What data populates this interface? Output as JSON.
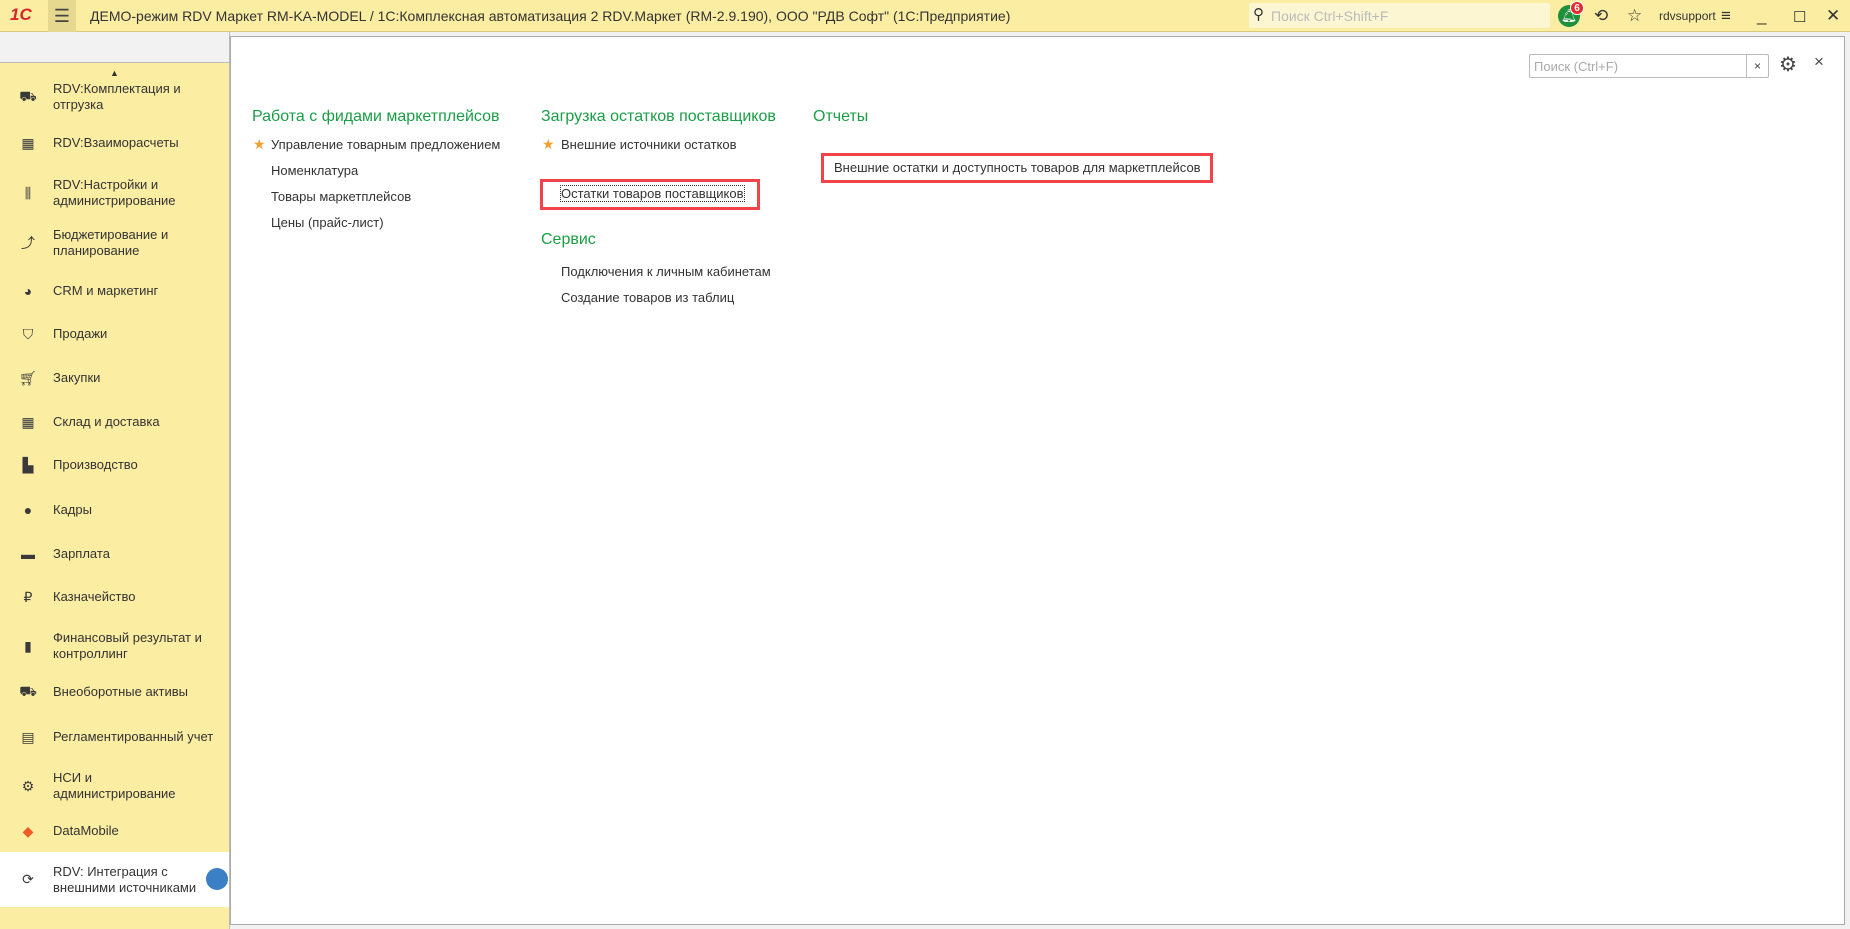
{
  "titlebar": {
    "logo": "1С",
    "title": "ДЕМО-режим RDV Маркет RM-KA-MODEL / 1С:Комплексная автоматизация 2 RDV.Маркет (RM-2.9.190), ООО \"РДВ Софт\"  (1С:Предприятие)",
    "search_placeholder": "Поиск Ctrl+Shift+F",
    "notifications": "6",
    "user": "rdvsupport"
  },
  "sidebar": {
    "items": [
      {
        "label": "RDV:Комплектация и отгрузка",
        "icon": "cart-dolly-icon"
      },
      {
        "label": "RDV:Взаиморасчеты",
        "icon": "calculator-icon"
      },
      {
        "label": "RDV:Настройки и администрирование",
        "icon": "sliders-icon"
      },
      {
        "label": "Бюджетирование и планирование",
        "icon": "budget-chart-icon"
      },
      {
        "label": "CRM и маркетинг",
        "icon": "pie-icon"
      },
      {
        "label": "Продажи",
        "icon": "bag-icon"
      },
      {
        "label": "Закупки",
        "icon": "cart-icon"
      },
      {
        "label": "Склад и доставка",
        "icon": "warehouse-icon"
      },
      {
        "label": "Производство",
        "icon": "factory-icon"
      },
      {
        "label": "Кадры",
        "icon": "person-icon"
      },
      {
        "label": "Зарплата",
        "icon": "card-icon"
      },
      {
        "label": "Казначейство",
        "icon": "ruble-icon"
      },
      {
        "label": "Финансовый результат и контроллинг",
        "icon": "bar-chart-icon"
      },
      {
        "label": "Внеоборотные активы",
        "icon": "truck-icon"
      },
      {
        "label": "Регламентированный учет",
        "icon": "register-icon"
      },
      {
        "label": "НСИ и администрирование",
        "icon": "gear-icon"
      },
      {
        "label": "DataMobile",
        "icon": "datamobile-icon"
      },
      {
        "label": "RDV: Интеграция с внешними источниками",
        "icon": "sync-icon"
      }
    ]
  },
  "main": {
    "search_placeholder": "Поиск (Ctrl+F)",
    "col1": {
      "heading": "Работа с фидами маркетплейсов",
      "items": [
        "Управление товарным предложением",
        "Номенклатура",
        "Товары маркетплейсов",
        "Цены (прайс-лист)"
      ]
    },
    "col2": {
      "heading": "Загрузка остатков поставщиков",
      "items": [
        "Внешние источники остатков",
        "Остатки товаров поставщиков"
      ],
      "heading2": "Сервис",
      "items2": [
        "Подключения к личным кабинетам",
        "Создание товаров из таблиц"
      ]
    },
    "col3": {
      "heading": "Отчеты",
      "items": [
        "Внешние остатки и доступность товаров для маркетплейсов"
      ]
    }
  },
  "colors": {
    "accent_green": "#1a9e45",
    "highlight_red": "#f0444a",
    "panel_yellow": "#fbeda2"
  }
}
